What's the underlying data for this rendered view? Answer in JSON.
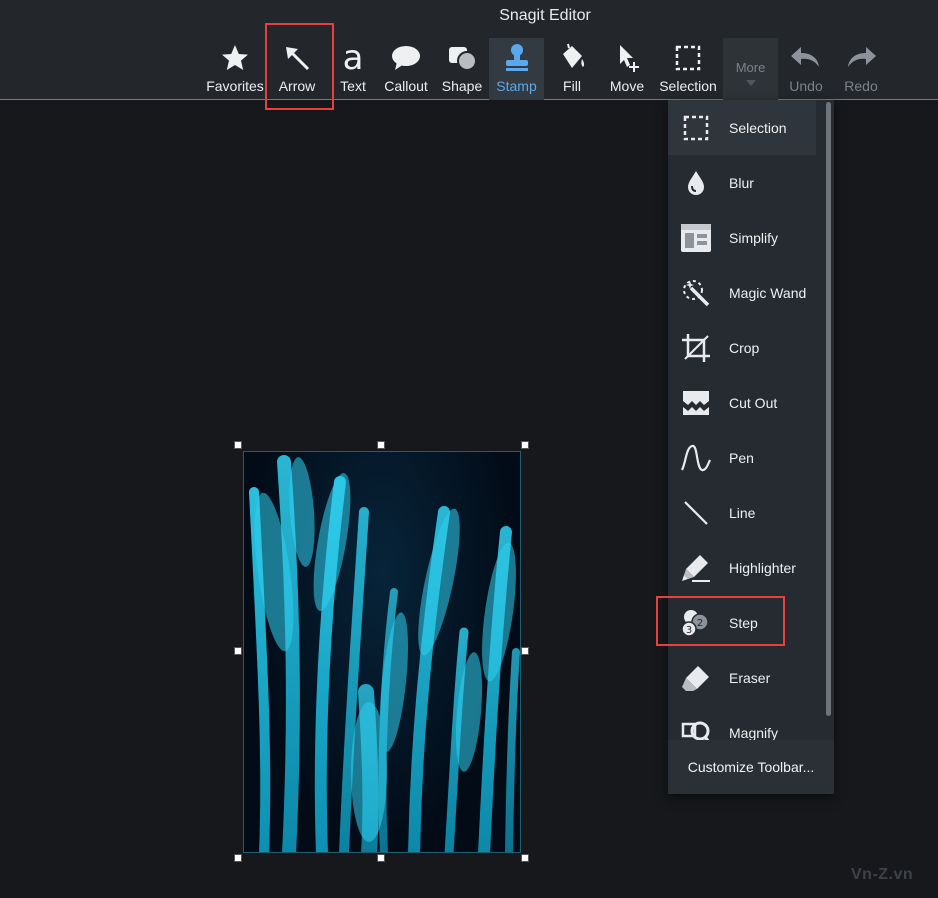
{
  "app": {
    "title": "Snagit Editor"
  },
  "toolbar": {
    "favorites": "Favorites",
    "arrow": "Arrow",
    "text": "Text",
    "callout": "Callout",
    "shape": "Shape",
    "stamp": "Stamp",
    "fill": "Fill",
    "move": "Move",
    "selection": "Selection",
    "more": "More",
    "undo": "Undo",
    "redo": "Redo",
    "active_tool": "Stamp",
    "accent_color": "#5aa9ec"
  },
  "more_menu": {
    "items": [
      {
        "label": "Selection",
        "icon": "selection-icon"
      },
      {
        "label": "Blur",
        "icon": "blur-drop-icon"
      },
      {
        "label": "Simplify",
        "icon": "simplify-icon"
      },
      {
        "label": "Magic Wand",
        "icon": "magic-wand-icon"
      },
      {
        "label": "Crop",
        "icon": "crop-icon"
      },
      {
        "label": "Cut Out",
        "icon": "cut-out-icon"
      },
      {
        "label": "Pen",
        "icon": "pen-icon"
      },
      {
        "label": "Line",
        "icon": "line-icon"
      },
      {
        "label": "Highlighter",
        "icon": "highlighter-icon"
      },
      {
        "label": "Step",
        "icon": "step-icon"
      },
      {
        "label": "Eraser",
        "icon": "eraser-icon"
      },
      {
        "label": "Magnify",
        "icon": "magnify-icon"
      }
    ],
    "customize": "Customize Toolbar..."
  },
  "highlight_color": "#e8403c",
  "watermark": "Vn-Z.vn"
}
